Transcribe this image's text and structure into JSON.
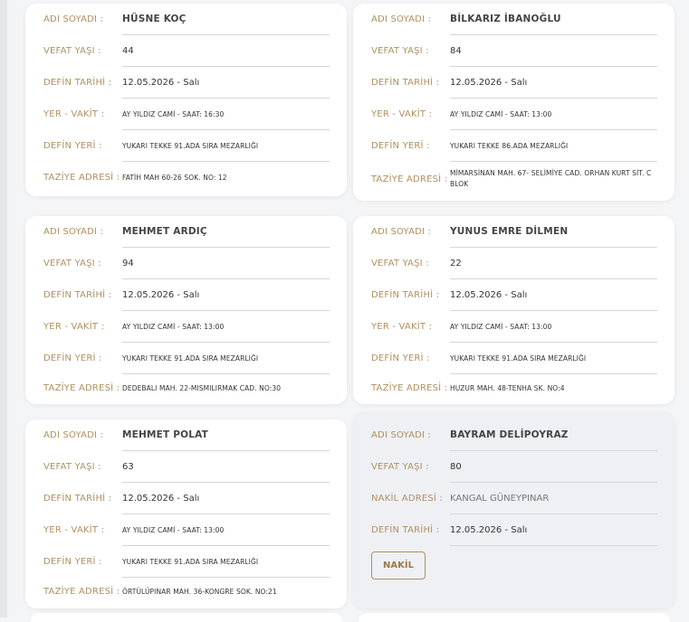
{
  "labels": {
    "name": "ADI SOYADI :",
    "age": "VEFAT YAŞI :",
    "date": "DEFİN TARİHİ :",
    "place_time": "YER - VAKİT :",
    "burial": "DEFİN YERİ :",
    "address": "TAZİYE ADRESİ :",
    "transfer": "NAKİL ADRESİ :"
  },
  "cards": [
    {
      "name": "HÜSNE KOÇ",
      "age": "44",
      "date": "12.05.2026 - Salı",
      "place_time": "AY YILDIZ CAMİ - SAAT: 16:30",
      "burial": "YUKARI TEKKE 91.ADA SIRA MEZARLIĞI",
      "address": "FATİH MAH 60-26 SOK. NO: 12"
    },
    {
      "name": "BİLKARIZ İBANOĞLU",
      "age": "84",
      "date": "12.05.2026 - Salı",
      "place_time": "AY YILDIZ CAMİ - SAAT: 13:00",
      "burial": "YUKARI TEKKE 86.ADA MEZARLIĞI",
      "address": "MİMARSİNAN MAH. 67- SELİMİYE CAD. ORHAN KURT SİT. C BLOK"
    },
    {
      "name": "MEHMET ARDIÇ",
      "age": "94",
      "date": "12.05.2026 - Salı",
      "place_time": "AY YILDIZ CAMİ - SAAT: 13:00",
      "burial": "YUKARI TEKKE 91.ADA SIRA MEZARLIĞI",
      "address": "DEDEBALI MAH. 22-MISMILIRMAK CAD. NO:30"
    },
    {
      "name": "YUNUS EMRE DİLMEN",
      "age": "22",
      "date": "12.05.2026 - Salı",
      "place_time": "AY YILDIZ CAMİ - SAAT: 13:00",
      "burial": "YUKARI TEKKE 91.ADA SIRA MEZARLIĞI",
      "address": "HUZUR MAH. 48-TENHA SK. NO:4"
    },
    {
      "name": "MEHMET POLAT",
      "age": "63",
      "date": "12.05.2026 - Salı",
      "place_time": "AY YILDIZ CAMİ - SAAT: 13:00",
      "burial": "YUKARI TEKKE 91.ADA SIRA MEZARLIĞI",
      "address": "ÖRTÜLÜPINAR MAH. 36-KONGRE SOK. NO:21"
    },
    {
      "name": "BAYRAM DELİPOYRAZ",
      "age": "80",
      "transfer": "KANGAL GÜNEYPINAR",
      "date": "12.05.2026 - Salı",
      "button": "NAKİL"
    }
  ]
}
